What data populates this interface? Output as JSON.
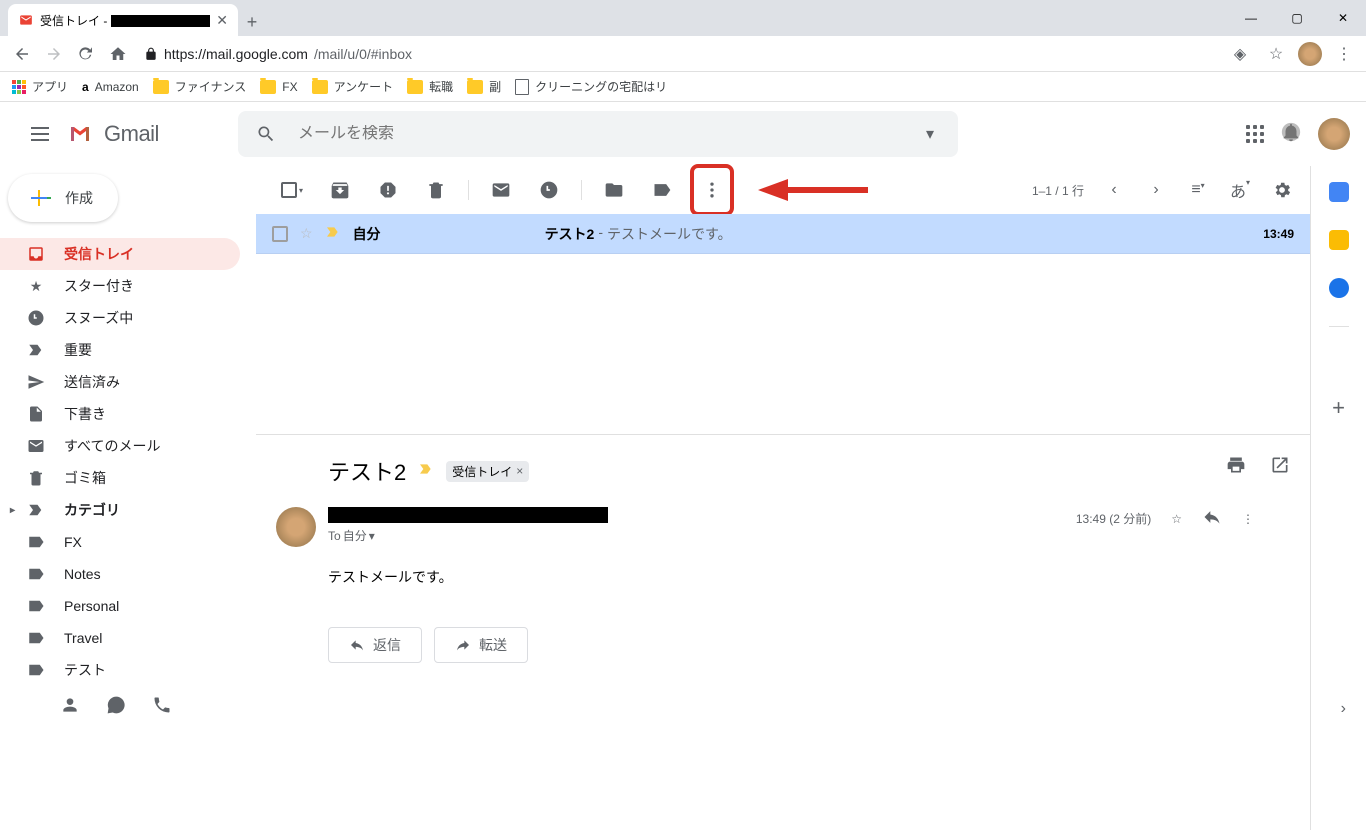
{
  "browser": {
    "tab_prefix": "受信トレイ",
    "url_host": "https://mail.google.com",
    "url_path": "/mail/u/0/#inbox",
    "bookmarks": [
      "アプリ",
      "Amazon",
      "ファイナンス",
      "FX",
      "アンケート",
      "転職",
      "副",
      "クリーニングの宅配はリ"
    ]
  },
  "gmail": {
    "brand": "Gmail",
    "search_placeholder": "メールを検索",
    "compose": "作成",
    "nav": [
      "受信トレイ",
      "スター付き",
      "スヌーズ中",
      "重要",
      "送信済み",
      "下書き",
      "すべてのメール",
      "ゴミ箱",
      "カテゴリ",
      "FX",
      "Notes",
      "Personal",
      "Travel",
      "テスト"
    ],
    "pager": "1–1 / 1 行",
    "lang": "あ"
  },
  "mail": {
    "sender": "自分",
    "subject": "テスト2",
    "preview_sep": " - ",
    "preview": "テストメールです。",
    "time": "13:49"
  },
  "reader": {
    "subject": "テスト2",
    "chip": "受信トレイ",
    "to_prefix": "To ",
    "to": "自分",
    "meta": "13:49 (2 分前)",
    "body": "テストメールです。",
    "reply": "返信",
    "forward": "転送"
  }
}
